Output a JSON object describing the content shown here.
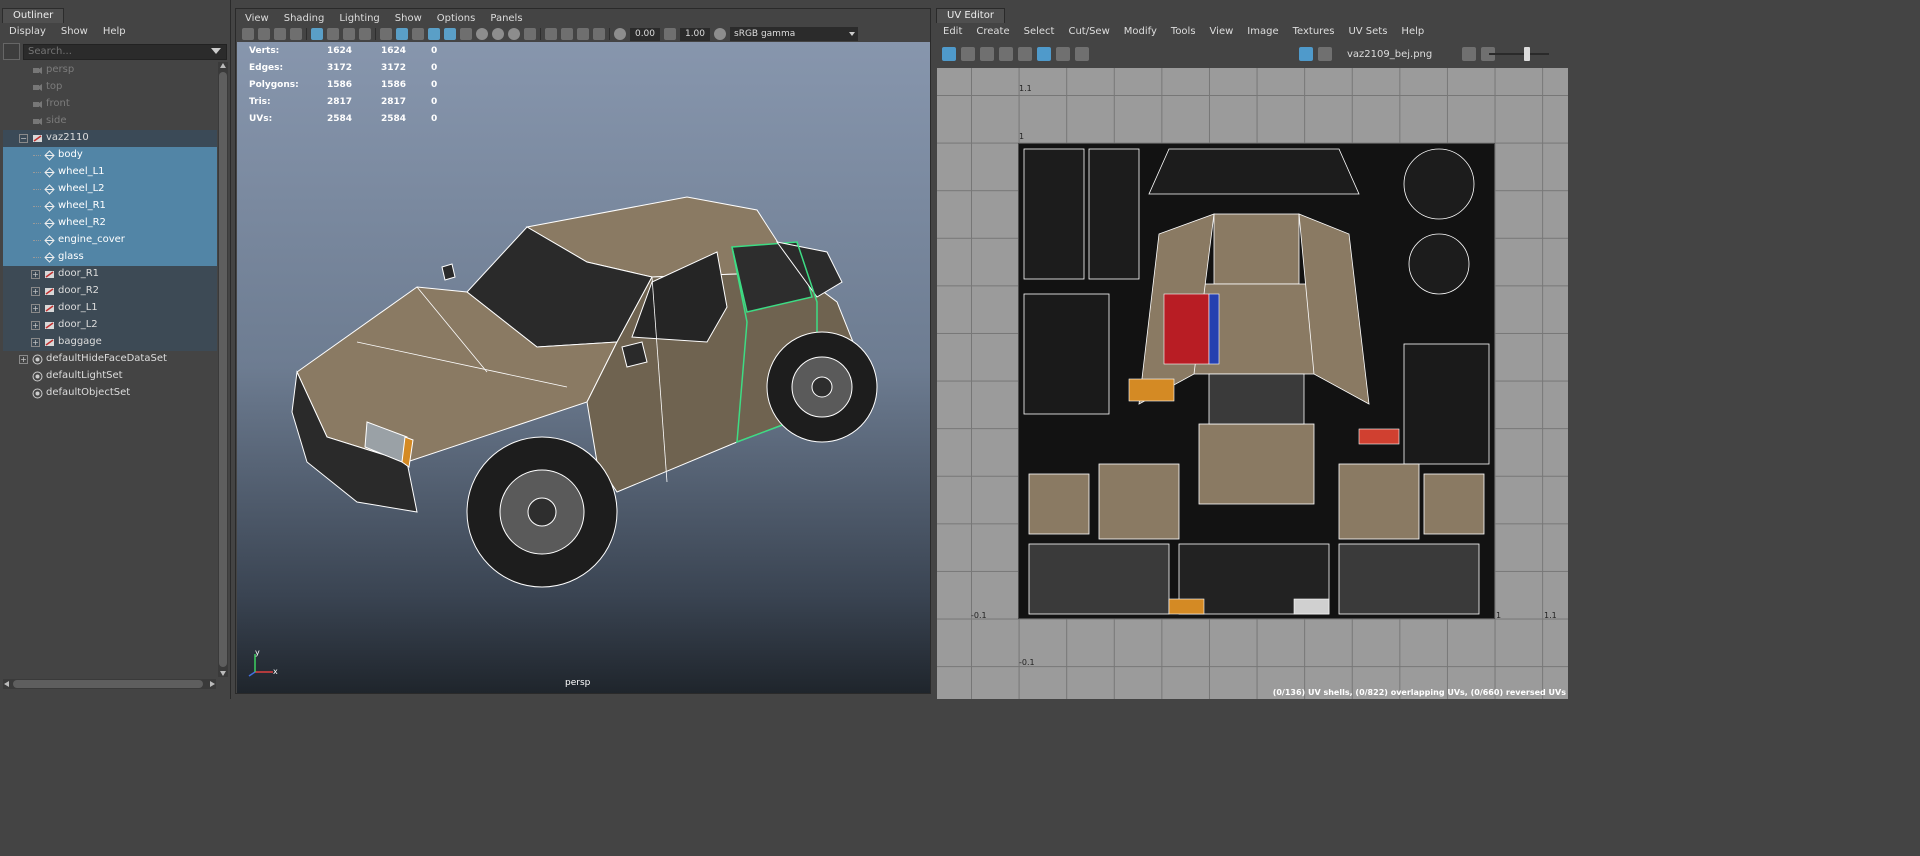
{
  "outliner": {
    "tab_title": "Outliner",
    "menu": [
      "Display",
      "Show",
      "Help"
    ],
    "search_placeholder": "Search...",
    "items": [
      {
        "label": "persp",
        "indent": 1,
        "icon": "camera-icon",
        "dim": true
      },
      {
        "label": "top",
        "indent": 1,
        "icon": "camera-icon",
        "dim": true
      },
      {
        "label": "front",
        "indent": 1,
        "icon": "camera-icon",
        "dim": true
      },
      {
        "label": "side",
        "indent": 1,
        "icon": "camera-icon",
        "dim": true
      },
      {
        "label": "vaz2110",
        "indent": 1,
        "icon": "transform-icon",
        "expander": "−",
        "state": "parent"
      },
      {
        "label": "body",
        "indent": 2,
        "icon": "mesh-icon",
        "state": "sel"
      },
      {
        "label": "wheel_L1",
        "indent": 2,
        "icon": "mesh-icon",
        "state": "sel"
      },
      {
        "label": "wheel_L2",
        "indent": 2,
        "icon": "mesh-icon",
        "state": "sel"
      },
      {
        "label": "wheel_R1",
        "indent": 2,
        "icon": "mesh-icon",
        "state": "sel"
      },
      {
        "label": "wheel_R2",
        "indent": 2,
        "icon": "mesh-icon",
        "state": "sel"
      },
      {
        "label": "engine_cover",
        "indent": 2,
        "icon": "mesh-icon",
        "state": "sel"
      },
      {
        "label": "glass",
        "indent": 2,
        "icon": "mesh-icon",
        "state": "sel"
      },
      {
        "label": "door_R1",
        "indent": 2,
        "icon": "transform-icon",
        "expander": "+",
        "state": "child"
      },
      {
        "label": "door_R2",
        "indent": 2,
        "icon": "transform-icon",
        "expander": "+",
        "state": "child"
      },
      {
        "label": "door_L1",
        "indent": 2,
        "icon": "transform-icon",
        "expander": "+",
        "state": "child"
      },
      {
        "label": "door_L2",
        "indent": 2,
        "icon": "transform-icon",
        "expander": "+",
        "state": "child"
      },
      {
        "label": "baggage",
        "indent": 2,
        "icon": "transform-icon",
        "expander": "+",
        "state": "child"
      },
      {
        "label": "defaultHideFaceDataSet",
        "indent": 1,
        "icon": "set-icon",
        "expander": "+"
      },
      {
        "label": "defaultLightSet",
        "indent": 1,
        "icon": "set-icon"
      },
      {
        "label": "defaultObjectSet",
        "indent": 1,
        "icon": "set-icon"
      }
    ]
  },
  "viewport": {
    "menu": [
      "View",
      "Shading",
      "Lighting",
      "Show",
      "Options",
      "Panels"
    ],
    "field_a": "0.00",
    "field_b": "1.00",
    "color_space": "sRGB gamma",
    "camera": "persp",
    "hud": [
      {
        "k": "Verts:",
        "a": "1624",
        "b": "1624",
        "c": "0"
      },
      {
        "k": "Edges:",
        "a": "3172",
        "b": "3172",
        "c": "0"
      },
      {
        "k": "Polygons:",
        "a": "1586",
        "b": "1586",
        "c": "0"
      },
      {
        "k": "Tris:",
        "a": "2817",
        "b": "2817",
        "c": "0"
      },
      {
        "k": "UVs:",
        "a": "2584",
        "b": "2584",
        "c": "0"
      }
    ],
    "axis": {
      "x": "x",
      "y": "y"
    }
  },
  "uv_editor": {
    "tab_title": "UV Editor",
    "menu": [
      "Edit",
      "Create",
      "Select",
      "Cut/Sew",
      "Modify",
      "Tools",
      "View",
      "Image",
      "Textures",
      "UV Sets",
      "Help"
    ],
    "texture_name": "vaz2109_bej.png",
    "coords": {
      "top_1_1": "1.1",
      "top_1": "1",
      "left_neg": "-0.1",
      "bottom_neg": "-0.1",
      "right_1": "1",
      "right_1_1": "1.1"
    },
    "status": "(0/136) UV shells, (0/822) overlapping UVs, (0/660) reversed UVs"
  },
  "colors": {
    "selection": "#5285a6",
    "viewport_top": "#8796ad",
    "viewport_bottom": "#1f252c",
    "car_body": "#8a7a63",
    "wire": "#ffffff",
    "selected_wire": "#3ddc84"
  }
}
